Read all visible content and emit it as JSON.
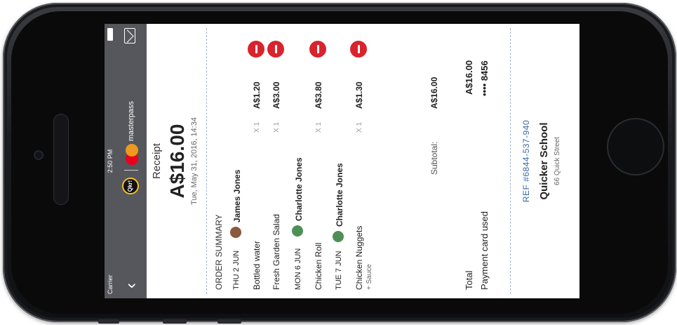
{
  "status_bar": {
    "carrier": "Carrier",
    "time": "2:50 PM"
  },
  "nav": {
    "back_icon": "chevron-left-icon",
    "logo_text": "Qkr!",
    "brand": "masterpass",
    "mail_icon": "envelope-icon"
  },
  "receipt": {
    "title": "Receipt",
    "total": "A$16.00",
    "date": "Tue, May 31, 2016, 14:34",
    "section_label": "ORDER SUMMARY",
    "groups": [
      {
        "day": "THU 2 JUN",
        "person": "James Jones",
        "items": [
          {
            "name": "Bottled water",
            "qty": "X 1",
            "price": "A$1.20"
          },
          {
            "name": "Fresh Garden Salad",
            "qty": "X 1",
            "price": "A$3.00"
          }
        ]
      },
      {
        "day": "MON 6 JUN",
        "person": "Charlotte  Jones",
        "items": [
          {
            "name": "Chicken Roll",
            "qty": "X 1",
            "price": "A$3.80"
          }
        ]
      },
      {
        "day": "TUE 7 JUN",
        "person": "Charlotte  Jones",
        "items": [
          {
            "name": "Chicken Nuggets",
            "sub": "+ Sauce",
            "qty": "X 1",
            "price": "A$1.30"
          }
        ]
      }
    ],
    "subtotal_label": "Subtotal:",
    "subtotal": "A$16.00",
    "total_label": "Total",
    "total_value": "A$16.00",
    "card_label": "Payment card used",
    "card_value": "•••• 8456",
    "ref": "REF #6844-537-940",
    "school": "Quicker School",
    "address": "66 Quick Street"
  },
  "colors": {
    "remove": "#d9232d",
    "nav_bg": "#56575c",
    "ref": "#3b6aa0"
  }
}
